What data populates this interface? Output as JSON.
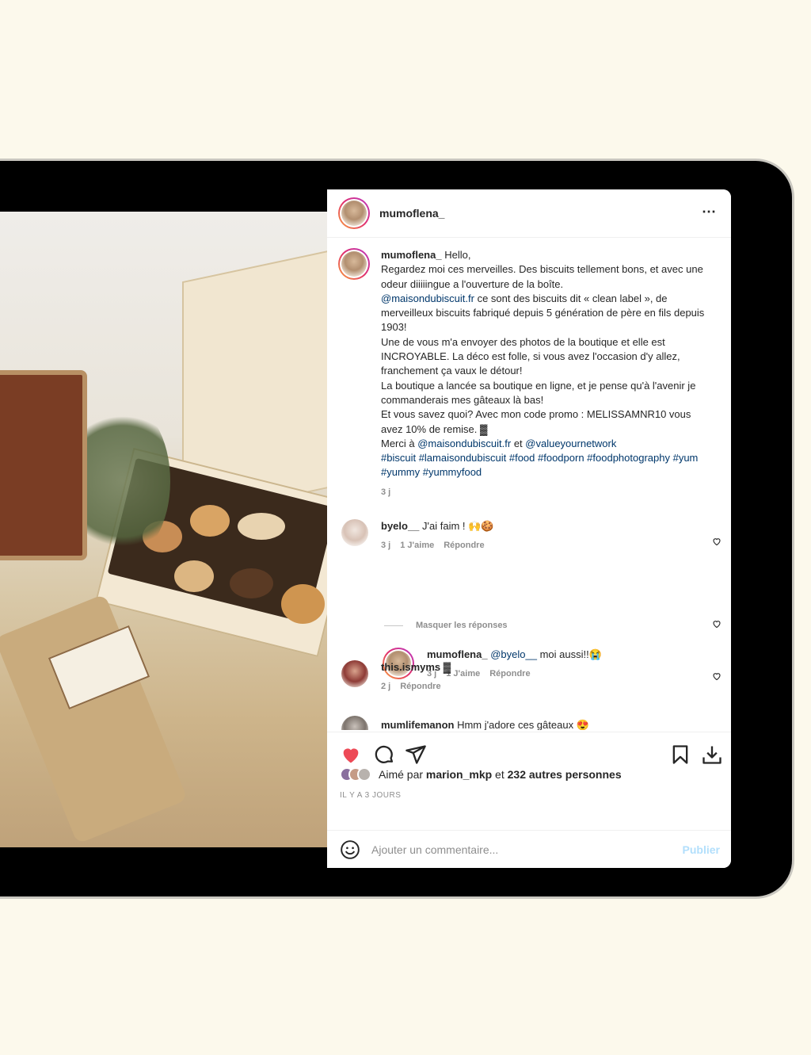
{
  "post": {
    "author": "mumoflena_",
    "more_icon": "⋯"
  },
  "caption": {
    "username": "mumoflena_",
    "line1": "Hello,",
    "line2": "Regardez moi ces merveilles. Des biscuits tellement bons, et avec une odeur diiiiingue a l'ouverture de la boîte.",
    "mention1": "@maisondubiscuit.fr",
    "line3": " ce sont des biscuits dit « clean label », de merveilleux biscuits fabriqué depuis 5 génération de père en fils depuis 1903!",
    "line4": "Une de vous m'a envoyer des photos de la boutique et elle est INCROYABLE. La déco est folle, si vous avez l'occasion d'y allez, franchement ça vaux le détour!",
    "line5": "La boutique a lancée sa boutique en ligne, et je pense qu'à l'avenir je commanderais mes gâteaux là bas!",
    "line6": "Et vous savez quoi? Avec mon code promo : MELISSAMNR10 vous avez 10% de remise. ▓",
    "thanks_prefix": "Merci à ",
    "mention2": "@maisondubiscuit.fr",
    "thanks_mid": " et ",
    "mention3": "@valueyournetwork",
    "hashtags": "#biscuit #lamaisondubiscuit #food #foodporn #foodphotography #yum #yummy #yummyfood",
    "time": "3 j"
  },
  "comments": [
    {
      "username": "byelo__",
      "text": " J'ai faim ! 🙌🍪",
      "time": "3 j",
      "likes": "1 J'aime",
      "reply": "Répondre"
    },
    {
      "username": "mumoflena_",
      "mention": "@byelo__",
      "text": " moi aussi!!😭",
      "time": "3 j",
      "likes": "1 J'aime",
      "reply": "Répondre"
    },
    {
      "username": "this.ismyms",
      "text": " ▓",
      "time": "2 j",
      "reply": "Répondre"
    },
    {
      "username": "mumlifemanon",
      "text": " Hmm j'adore ces gâteaux 😍"
    }
  ],
  "hide_replies": "Masquer les réponses",
  "likes": {
    "prefix": "Aimé par ",
    "user": "marion_mkp",
    "mid": " et ",
    "others": "232 autres personnes"
  },
  "timestamp": "IL Y A 3 JOURS",
  "add_comment": {
    "placeholder": "Ajouter un commentaire...",
    "publish": "Publier"
  },
  "colors": {
    "background": "#fcf9ec",
    "like_red": "#ed4956",
    "link_blue": "#00376b",
    "publish_disabled": "#b2dffc"
  }
}
